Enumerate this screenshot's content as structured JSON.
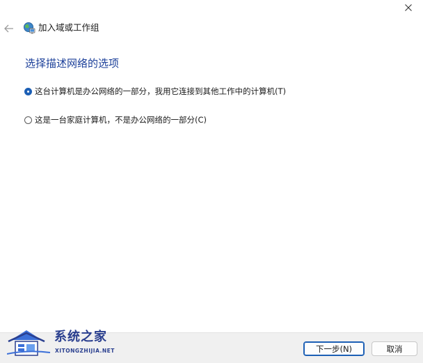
{
  "window": {
    "close_icon": "close-icon"
  },
  "header": {
    "back_icon": "back-arrow-icon",
    "wizard_icon": "network-globe-icon",
    "title": "加入域或工作组"
  },
  "page": {
    "heading": "选择描述网络的选项"
  },
  "options": [
    {
      "label": "这台计算机是办公网络的一部分，我用它连接到其他工作中的计算机(T)",
      "selected": true
    },
    {
      "label": "这是一台家庭计算机，不是办公网络的一部分(C)",
      "selected": false
    }
  ],
  "footer": {
    "next_label": "下一步(N)",
    "cancel_label": "取消"
  },
  "watermark": {
    "name": "系统之家",
    "url": "XITONGZHIJIA.NET"
  },
  "colors": {
    "accent": "#1c5fb5",
    "heading": "#1b3f99",
    "footer_bg": "#f0f0f0"
  }
}
